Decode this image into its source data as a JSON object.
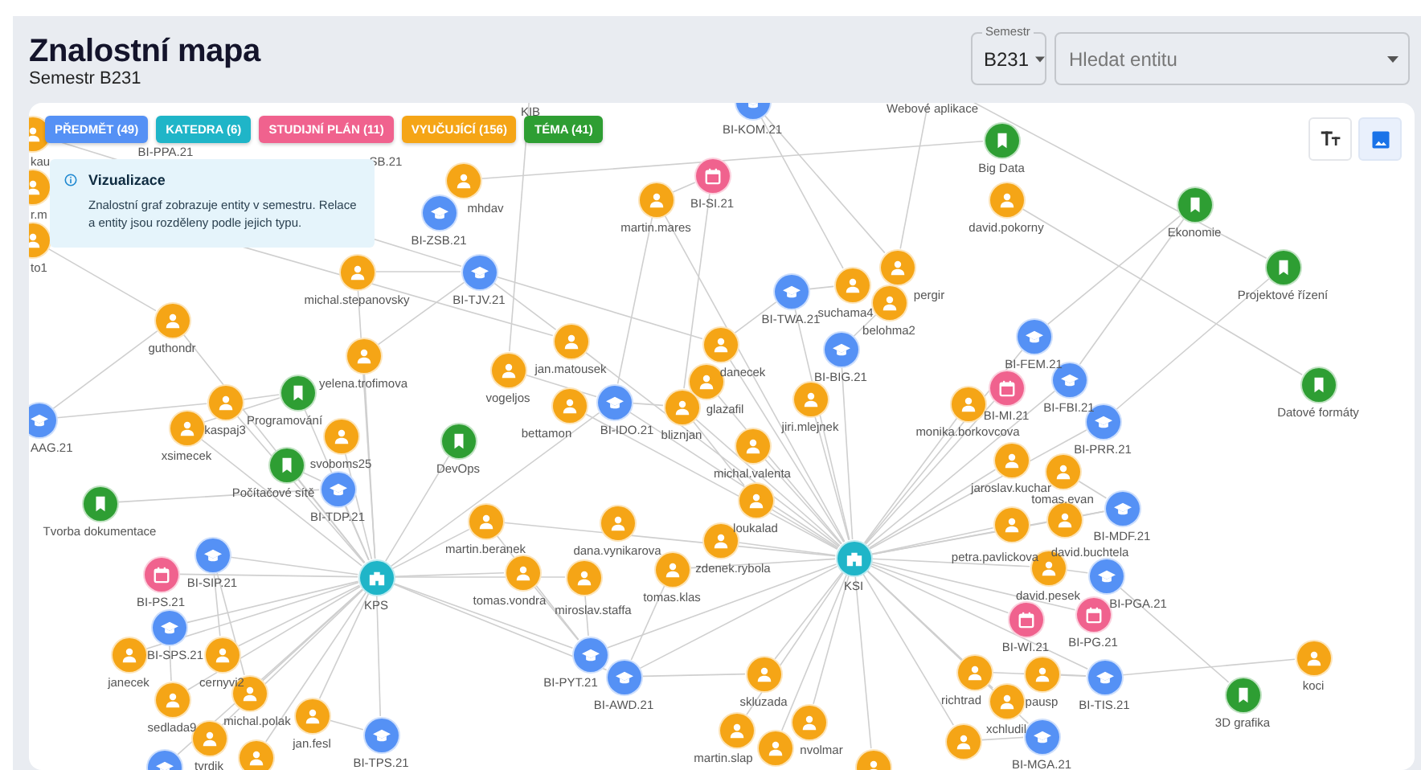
{
  "header": {
    "title": "Znalostní mapa",
    "subtitle": "Semestr B231"
  },
  "semester_select": {
    "label": "Semestr",
    "value": "B231"
  },
  "search": {
    "placeholder": "Hledat entitu"
  },
  "legend": [
    {
      "kind": "subject",
      "label": "PŘEDMĚT (49)"
    },
    {
      "kind": "department",
      "label": "KATEDRA (6)"
    },
    {
      "kind": "plan",
      "label": "STUDIJNÍ PLÁN (11)"
    },
    {
      "kind": "teacher",
      "label": "VYUČUJÍCÍ (156)"
    },
    {
      "kind": "topic",
      "label": "TÉMA (41)"
    }
  ],
  "info": {
    "title": "Vizualizace",
    "text": "Znalostní graf zobrazuje entity v semestru. Relace a entity jsou rozděleny podle jejich typu."
  },
  "view_tools": [
    {
      "kind": "text-size",
      "selected": false
    },
    {
      "kind": "image",
      "selected": true
    }
  ],
  "nodes": [
    {
      "label": "KIB"
    },
    {
      "kind": "subject",
      "label": "BI-KOM.21"
    },
    {
      "label": "Webové aplikace"
    },
    {
      "kind": "teacher",
      "label": "kau"
    },
    {
      "label": "BI-PPA.21"
    },
    {
      "label": "SB.21"
    },
    {
      "kind": "topic",
      "label": "Big Data"
    },
    {
      "kind": "teacher",
      "label": "r.m"
    },
    {
      "kind": "teacher",
      "label": "mhdav"
    },
    {
      "kind": "plan",
      "label": "BI-SI.21"
    },
    {
      "kind": "subject",
      "label": "BI-ZSB.21"
    },
    {
      "kind": "teacher",
      "label": "martin.mares"
    },
    {
      "kind": "teacher",
      "label": "david.pokorny"
    },
    {
      "kind": "topic",
      "label": "Ekonomie"
    },
    {
      "kind": "teacher",
      "label": "to1"
    },
    {
      "kind": "teacher",
      "label": "michal.stepanovsky"
    },
    {
      "kind": "subject",
      "label": "BI-TJV.21"
    },
    {
      "kind": "teacher",
      "label": "pergir"
    },
    {
      "kind": "topic",
      "label": "Projektové řízení"
    },
    {
      "kind": "subject",
      "label": "BI-TWA.21"
    },
    {
      "kind": "teacher",
      "label": "suchama4"
    },
    {
      "kind": "teacher",
      "label": "belohma2"
    },
    {
      "kind": "teacher",
      "label": "guthondr"
    },
    {
      "kind": "subject",
      "label": "BI-FEM.21"
    },
    {
      "kind": "teacher",
      "label": "yelena.trofimova"
    },
    {
      "kind": "teacher",
      "label": "jan.matousek"
    },
    {
      "kind": "teacher",
      "label": "danecek"
    },
    {
      "kind": "subject",
      "label": "BI-BIG.21"
    },
    {
      "kind": "teacher",
      "label": "vogeljos"
    },
    {
      "kind": "teacher",
      "label": "glazafil"
    },
    {
      "kind": "subject",
      "label": "BI-FBI.21"
    },
    {
      "kind": "topic",
      "label": "Datové formáty"
    },
    {
      "kind": "teacher",
      "label": "kaspaj3"
    },
    {
      "kind": "topic",
      "label": "Programování"
    },
    {
      "kind": "subject",
      "label": "BI-IDO.21"
    },
    {
      "kind": "teacher",
      "label": "jiri.mlejnek"
    },
    {
      "kind": "plan",
      "label": "BI-MI.21"
    },
    {
      "kind": "teacher",
      "label": "monika.borkovcova"
    },
    {
      "kind": "subject",
      "label": "AAG.21"
    },
    {
      "kind": "teacher",
      "label": "bettamon"
    },
    {
      "kind": "teacher",
      "label": "bliznjan"
    },
    {
      "kind": "subject",
      "label": "BI-PRR.21"
    },
    {
      "kind": "teacher",
      "label": "xsimecek"
    },
    {
      "kind": "teacher",
      "label": "svoboms25"
    },
    {
      "kind": "topic",
      "label": "DevOps"
    },
    {
      "kind": "teacher",
      "label": "michal.valenta"
    },
    {
      "kind": "topic",
      "label": "Počítačové sítě"
    },
    {
      "kind": "teacher",
      "label": "jaroslav.kuchar"
    },
    {
      "kind": "teacher",
      "label": "tomas.evan"
    },
    {
      "kind": "topic",
      "label": "Tvorba dokumentace"
    },
    {
      "kind": "subject",
      "label": "BI-TDP.21"
    },
    {
      "kind": "teacher",
      "label": "loukalad"
    },
    {
      "kind": "subject",
      "label": "BI-MDF.21"
    },
    {
      "kind": "teacher",
      "label": "martin.beranek"
    },
    {
      "kind": "teacher",
      "label": "dana.vynikarova"
    },
    {
      "kind": "teacher",
      "label": "petra.pavlickova"
    },
    {
      "kind": "teacher",
      "label": "david.buchtela"
    },
    {
      "kind": "subject",
      "label": "BI-SIP.21"
    },
    {
      "kind": "teacher",
      "label": "zdenek.rybola"
    },
    {
      "kind": "plan",
      "label": "BI-PS.21"
    },
    {
      "kind": "teacher",
      "label": "tomas.vondra"
    },
    {
      "kind": "teacher",
      "label": "tomas.klas"
    },
    {
      "kind": "department",
      "label": "KSI"
    },
    {
      "kind": "teacher",
      "label": "david.pesek"
    },
    {
      "kind": "department",
      "label": "KPS"
    },
    {
      "kind": "teacher",
      "label": "miroslav.staffa"
    },
    {
      "kind": "subject",
      "label": "BI-PGA.21"
    },
    {
      "kind": "subject",
      "label": "BI-SPS.21"
    },
    {
      "kind": "plan",
      "label": "BI-WI.21"
    },
    {
      "kind": "plan",
      "label": "BI-PG.21"
    },
    {
      "kind": "teacher",
      "label": "janecek"
    },
    {
      "kind": "teacher",
      "label": "cernyvi2"
    },
    {
      "kind": "subject",
      "label": "BI-PYT.21"
    },
    {
      "kind": "teacher",
      "label": "koci"
    },
    {
      "kind": "subject",
      "label": "BI-AWD.21"
    },
    {
      "kind": "teacher",
      "label": "skluzada"
    },
    {
      "kind": "teacher",
      "label": "richtrad"
    },
    {
      "kind": "teacher",
      "label": "pausp"
    },
    {
      "kind": "subject",
      "label": "BI-TIS.21"
    },
    {
      "kind": "teacher",
      "label": "sedlada9"
    },
    {
      "kind": "teacher",
      "label": "michal.polak"
    },
    {
      "kind": "teacher",
      "label": "xchludil"
    },
    {
      "kind": "topic",
      "label": "3D grafika"
    },
    {
      "kind": "teacher",
      "label": "jan.fesl"
    },
    {
      "kind": "teacher",
      "label": "martin.slap"
    },
    {
      "kind": "teacher",
      "label": "nvolmar"
    },
    {
      "kind": "teacher",
      "label": "tvrdik"
    },
    {
      "kind": "subject",
      "label": "BI-TPS.21"
    },
    {
      "kind": "teacher"
    },
    {
      "kind": "teacher"
    },
    {
      "kind": "subject",
      "label": "BI-MGA.21"
    },
    {
      "kind": "subject"
    },
    {
      "kind": "teacher"
    },
    {
      "kind": "teacher"
    }
  ]
}
